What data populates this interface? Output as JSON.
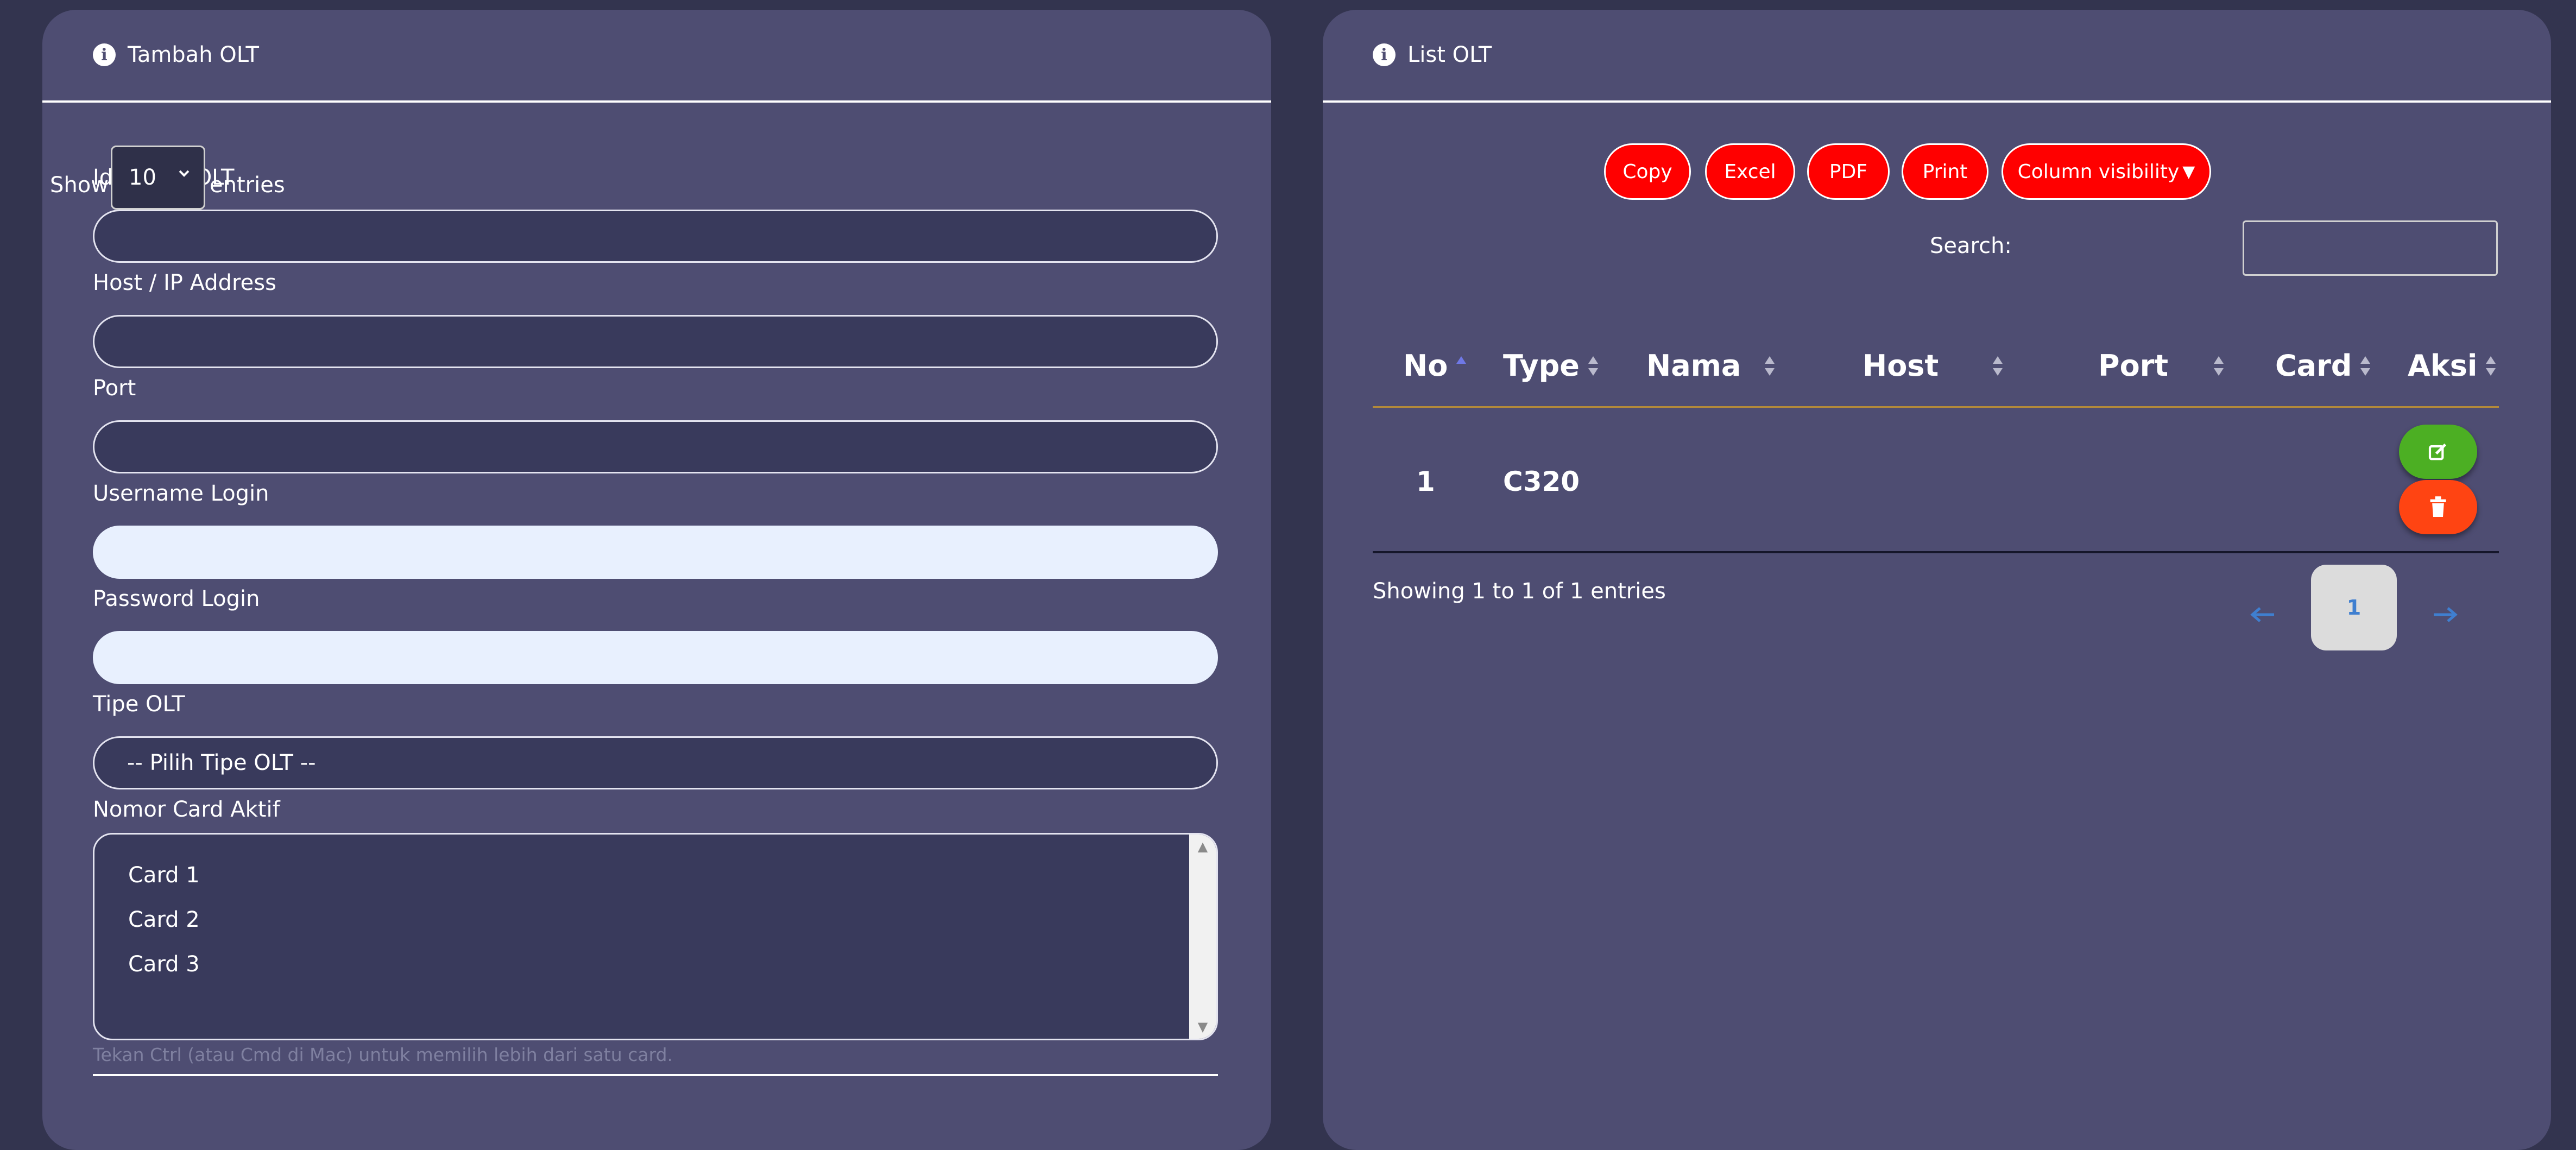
{
  "add_form": {
    "title": "Tambah OLT",
    "fields": {
      "identity_label": "Identitas OLT",
      "host_label": "Host / IP Address",
      "port_label": "Port",
      "username_label": "Username Login",
      "password_label": "Password Login",
      "type_label": "Tipe OLT",
      "type_value": "-- Pilih Tipe OLT --",
      "card_label": "Nomor Card Aktif",
      "card_options": [
        "Card 1",
        "Card 2",
        "Card 3"
      ],
      "card_hint": "Tekan Ctrl (atau Cmd di Mac) untuk memilih lebih dari satu card."
    }
  },
  "list": {
    "title": "List OLT",
    "show_label": "Show",
    "page_length": "10",
    "entries_label": "entries",
    "buttons": {
      "copy": "Copy",
      "excel": "Excel",
      "pdf": "PDF",
      "print": "Print",
      "colvis": "Column visibility"
    },
    "search_label": "Search:",
    "columns": [
      "No",
      "Type",
      "Nama",
      "Host",
      "Port",
      "Card",
      "Aksi"
    ],
    "rows": [
      {
        "no": "1",
        "type": "C320",
        "nama": "",
        "host": "",
        "port": "",
        "card": ""
      }
    ],
    "info": "Showing 1 to 1 of 1 entries",
    "current_page": "1"
  },
  "colors": {
    "background": "#33344f",
    "card": "#4e4d72",
    "input": "#393a5c",
    "autofill": "#e8f0fe",
    "export_button": "#ff0000",
    "edit_button": "#4caf23",
    "delete_button": "#ff4412",
    "pagination_arrow": "#3f7fd0"
  },
  "icons": {
    "header": "info-circle-icon",
    "edit": "edit-icon",
    "delete": "trash-icon",
    "prev": "arrow-left-icon",
    "next": "arrow-right-icon",
    "dropdown": "caret-down-icon"
  }
}
